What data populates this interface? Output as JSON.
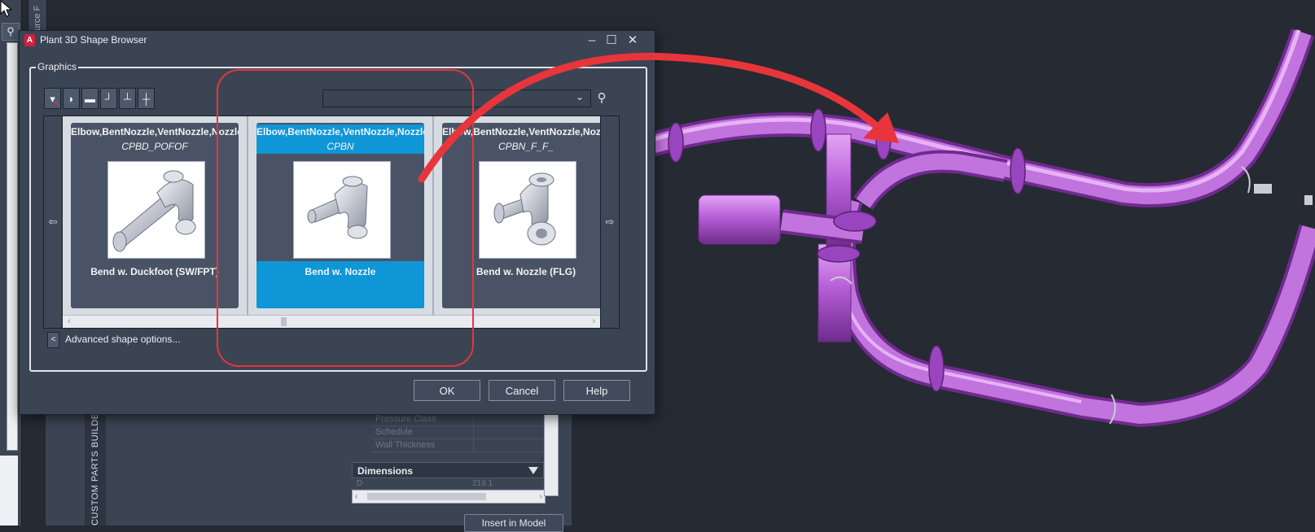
{
  "background": {
    "vertical_title": "ource F",
    "vertical_tab": "CUSTOM PARTS BUILDER",
    "properties": [
      {
        "label": "Pressure Class",
        "value": ""
      },
      {
        "label": "Schedule",
        "value": ""
      },
      {
        "label": "Wall Thickness",
        "value": ""
      }
    ],
    "dimensions_header": "Dimensions",
    "dimension_row": {
      "label": "D",
      "value": "219.1"
    },
    "insert_button": "Insert in Model"
  },
  "dialog": {
    "title": "Plant 3D Shape Browser",
    "group_label": "Graphics",
    "search": {
      "value": "",
      "placeholder": ""
    },
    "cards": [
      {
        "category": "Elbow,BentNozzle,VentNozzle,Nozzle",
        "code": "CPBD_POFOF",
        "name": "Bend w. Duckfoot (SW/FPT)",
        "selected": false
      },
      {
        "category": "Elbow,BentNozzle,VentNozzle,Nozzle",
        "code": "CPBN",
        "name": "Bend w. Nozzle",
        "selected": true
      },
      {
        "category": "Elbow,BentNozzle,VentNozzle,Nozzle",
        "code": "CPBN_F_F_",
        "name": "Bend w. Nozzle (FLG)",
        "selected": false
      }
    ],
    "advanced_label": "Advanced shape options...",
    "buttons": {
      "ok": "OK",
      "cancel": "Cancel",
      "help": "Help"
    }
  },
  "colors": {
    "accent_selected": "#0e96d6",
    "annotation_red": "#e8353b",
    "pipe_purple": "#b65ed6"
  }
}
